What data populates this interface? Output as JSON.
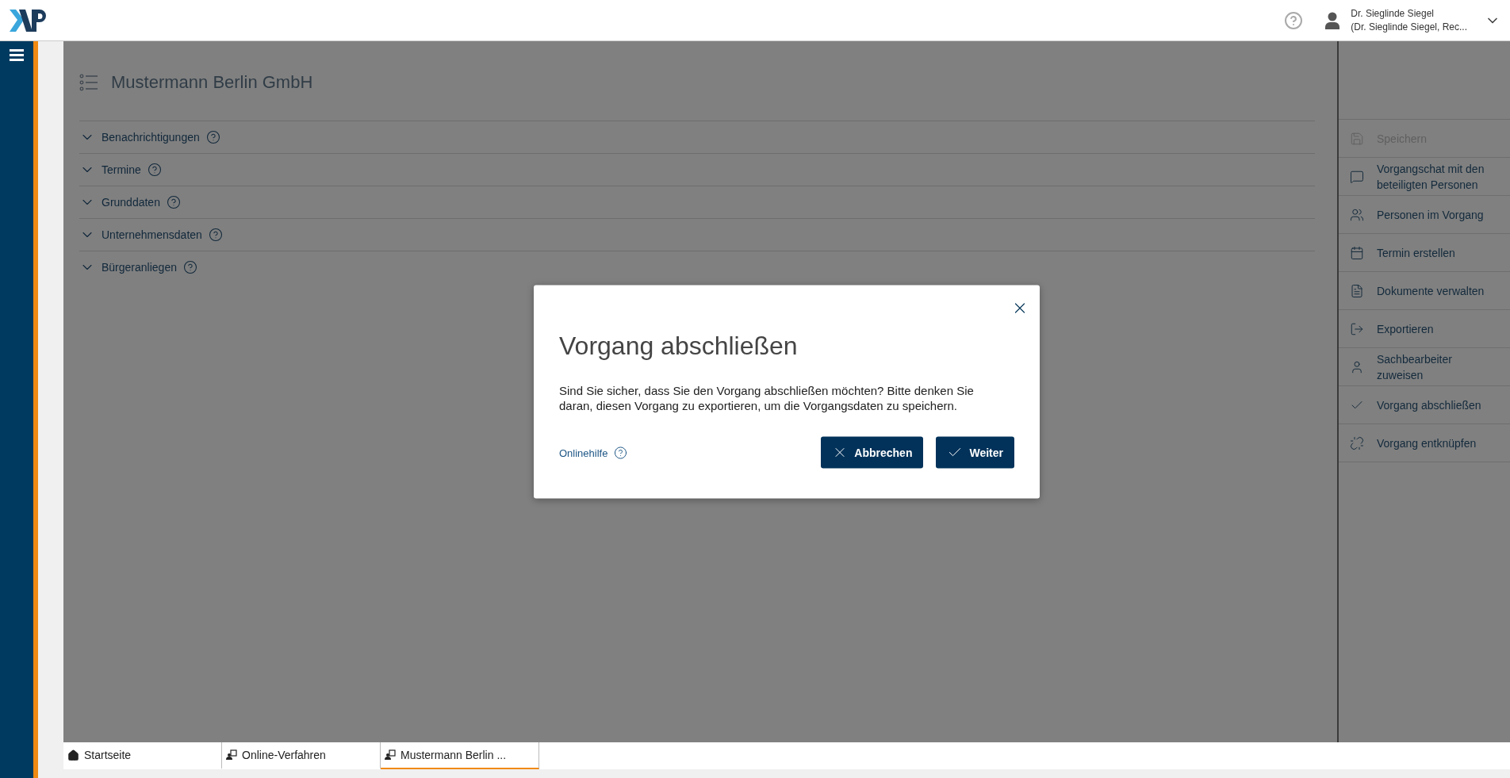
{
  "top_bar": {
    "user_name": "Dr. Sieglinde Siegel",
    "user_role": "(Dr. Sieglinde Siegel, Rec..."
  },
  "page": {
    "title": "Mustermann Berlin GmbH",
    "sections": [
      {
        "label": "Benachrichtigungen",
        "expanded": false
      },
      {
        "label": "Termine",
        "expanded": false
      },
      {
        "label": "Grunddaten",
        "expanded": false
      },
      {
        "label": "Unternehmensdaten",
        "expanded": false
      },
      {
        "label": "Bürgeranliegen",
        "expanded": false
      }
    ]
  },
  "actions": [
    {
      "label": "Speichern",
      "disabled": true
    },
    {
      "label": "Vorgangschat mit den beteiligten Personen",
      "disabled": false
    },
    {
      "label": "Personen im Vorgang",
      "disabled": false
    },
    {
      "label": "Termin erstellen",
      "disabled": false
    },
    {
      "label": "Dokumente verwalten",
      "disabled": false
    },
    {
      "label": "Exportieren",
      "disabled": false
    },
    {
      "label": "Sachbearbeiter zuweisen",
      "disabled": false
    },
    {
      "label": "Vorgang abschließen",
      "disabled": false
    },
    {
      "label": "Vorgang entknüpfen",
      "disabled": false
    }
  ],
  "dialog": {
    "title": "Vorgang abschließen",
    "message": "Sind Sie sicher, dass Sie den Vorgang abschließen möchten? Bitte denken Sie daran, diesen Vorgang zu exportieren, um die Vorgangsdaten zu speichern.",
    "help_link": "Onlinehilfe",
    "buttons": [
      {
        "label": "Abbrechen",
        "kind": "cancel"
      },
      {
        "label": "Weiter",
        "kind": "confirm"
      }
    ]
  },
  "tabs": [
    {
      "label": "Startseite",
      "kind": "home",
      "selected": false
    },
    {
      "label": "Online-Verfahren",
      "kind": "process",
      "selected": false
    },
    {
      "label": "Mustermann Berlin ...",
      "kind": "process",
      "selected": true
    }
  ]
}
